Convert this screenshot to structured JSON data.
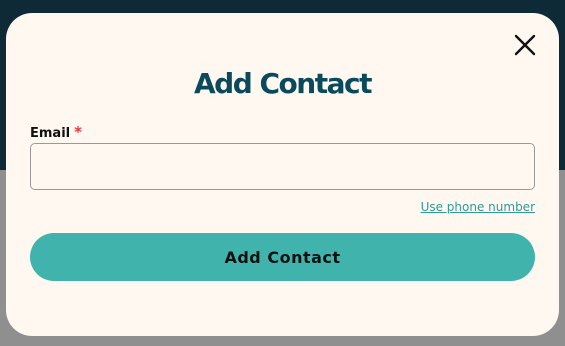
{
  "modal": {
    "title": "Add Contact",
    "close_icon": "close-icon",
    "email": {
      "label": "Email",
      "required_marker": "*",
      "value": "",
      "placeholder": ""
    },
    "alt_link": "Use phone number",
    "submit_label": "Add Contact"
  },
  "colors": {
    "title": "#0b4a5c",
    "accent": "#3fb3ac",
    "link": "#2f9a98",
    "required": "#e23b3b",
    "modal_bg": "#fef8f1",
    "backdrop_dark": "#0e2a36"
  }
}
